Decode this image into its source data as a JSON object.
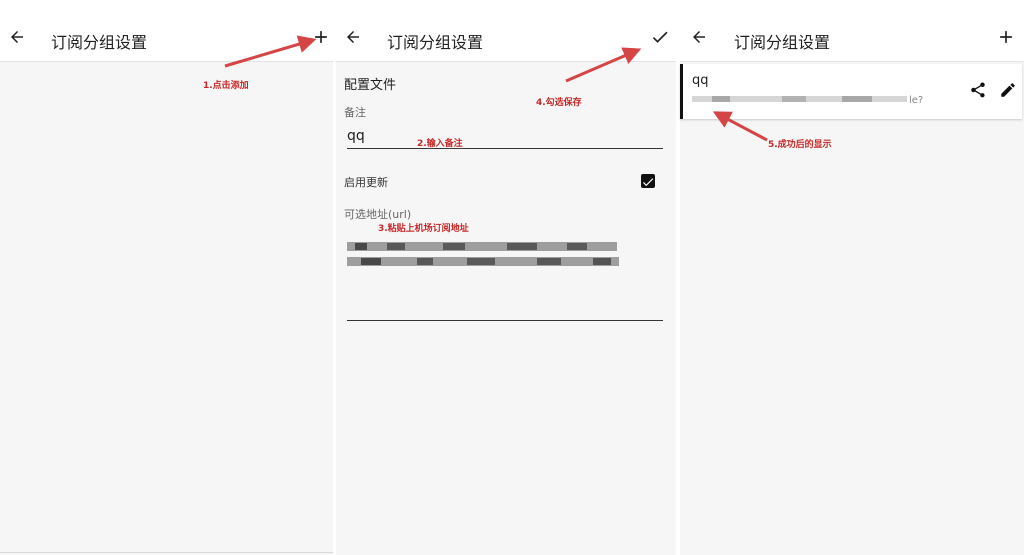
{
  "panels": [
    {
      "title": "订阅分组设置",
      "back_icon": "arrow-left-icon",
      "action_icon": "plus-icon"
    },
    {
      "title": "订阅分组设置",
      "back_icon": "arrow-left-icon",
      "action_icon": "check-icon",
      "form": {
        "section_title": "配置文件",
        "remark_label": "备注",
        "remark_value": "qq",
        "enable_update_label": "启用更新",
        "enable_update_checked": true,
        "url_label": "可选地址(url)"
      }
    },
    {
      "title": "订阅分组设置",
      "back_icon": "arrow-left-icon",
      "action_icon": "plus-icon",
      "card": {
        "title": "qq",
        "subtitle_tail": "le?",
        "share_icon": "share-icon",
        "edit_icon": "pencil-icon"
      }
    }
  ],
  "annotations": [
    "1.点击添加",
    "2.输入备注",
    "3.粘贴上机场订阅地址",
    "4.勾选保存",
    "5.成功后的显示"
  ],
  "colors": {
    "annotation": "#c62828",
    "arrow": "#d64545",
    "background": "#f6f6f6",
    "appbar": "#ffffff"
  }
}
